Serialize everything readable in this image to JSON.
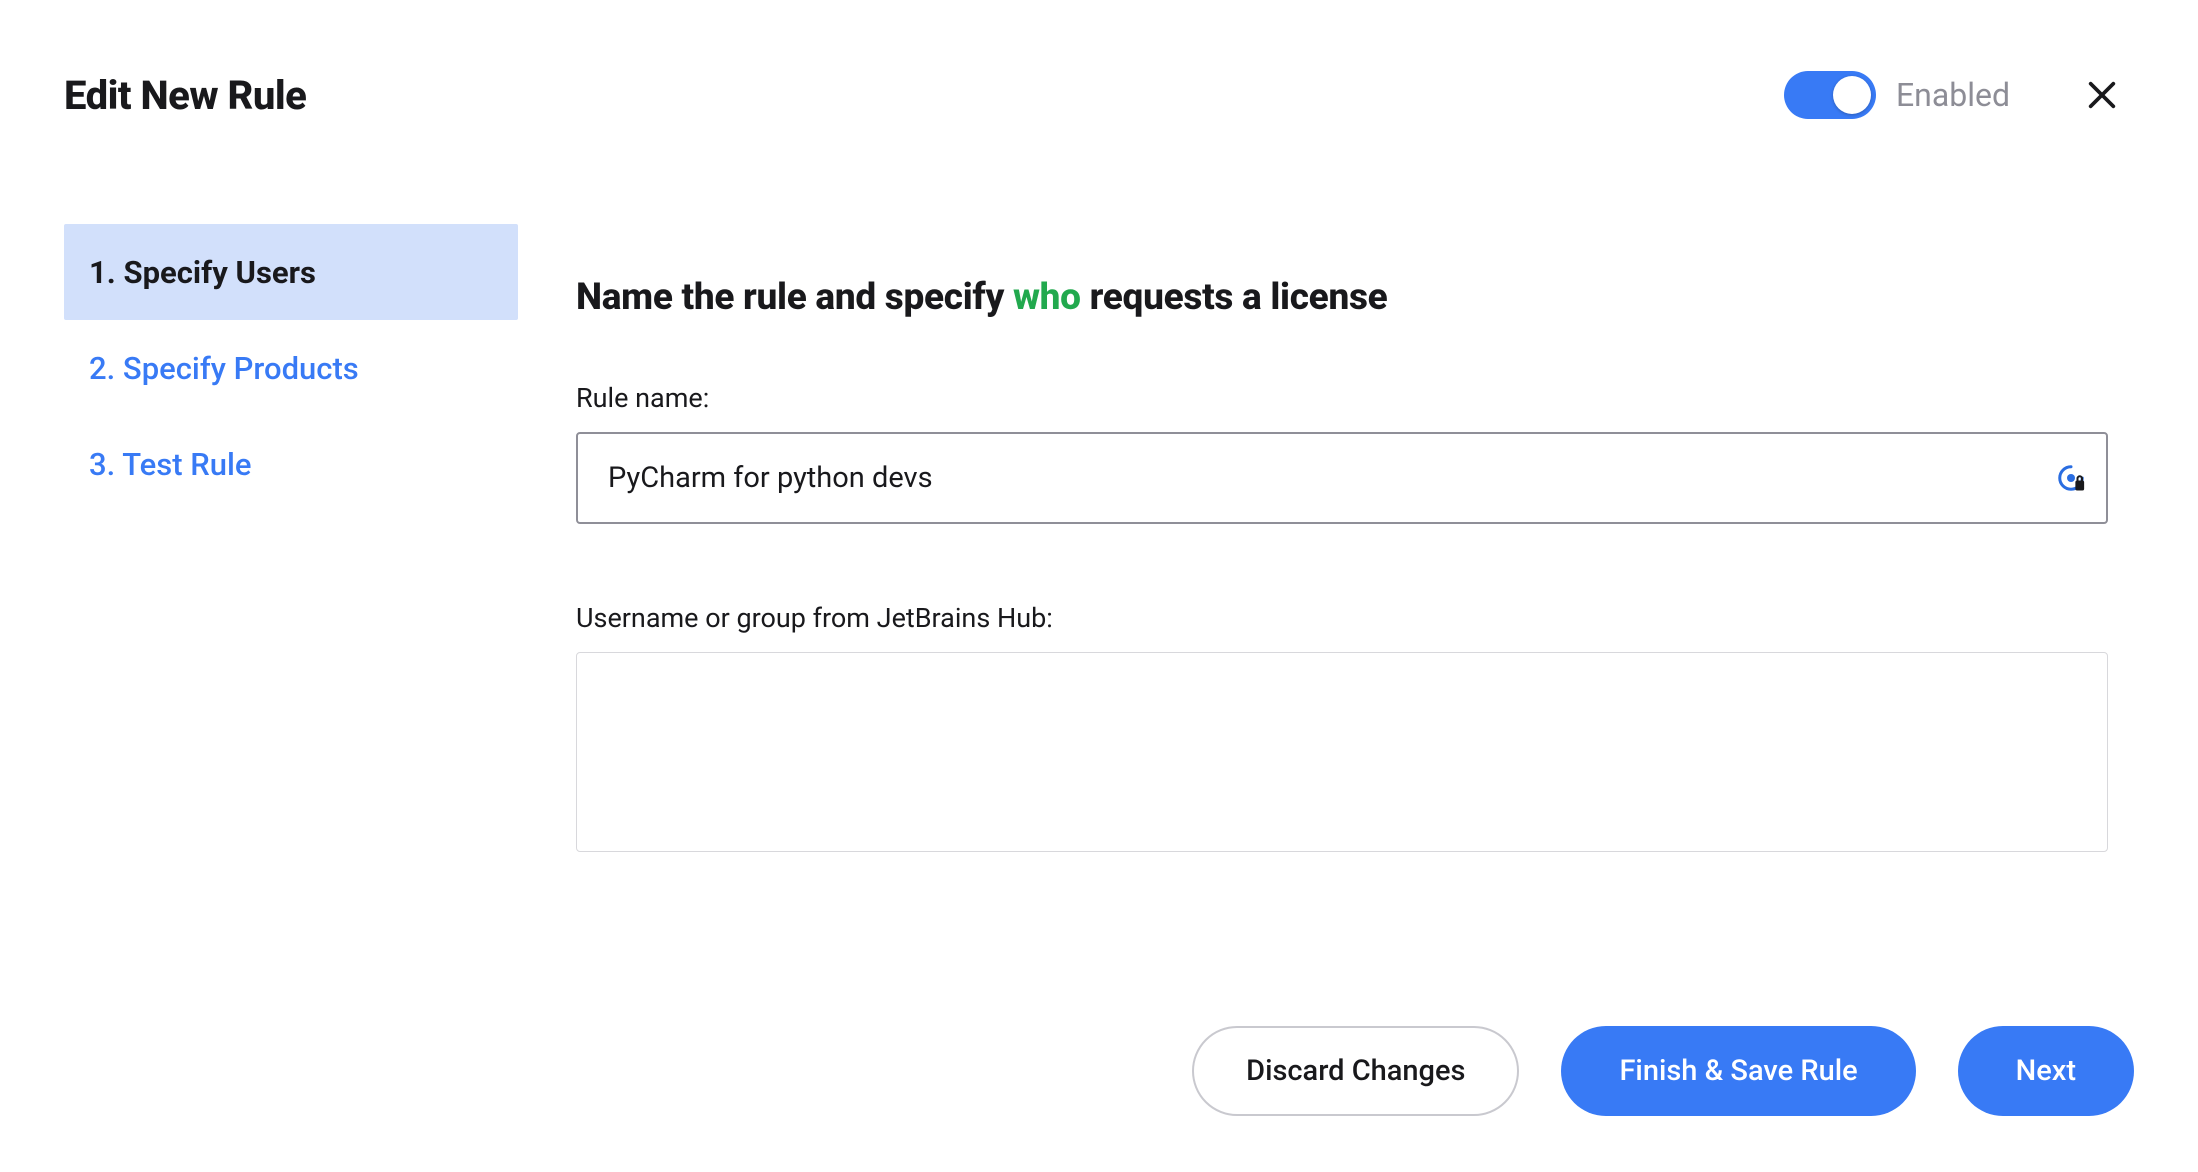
{
  "header": {
    "title": "Edit New Rule",
    "toggle_label": "Enabled",
    "toggle_on": true
  },
  "sidebar": {
    "steps": [
      {
        "label": "1. Specify Users",
        "active": true
      },
      {
        "label": "2. Specify Products",
        "active": false
      },
      {
        "label": "3. Test Rule",
        "active": false
      }
    ]
  },
  "main": {
    "heading_prefix": "Name the rule and specify ",
    "heading_highlight": "who",
    "heading_suffix": " requests a license",
    "rule_name_label": "Rule name:",
    "rule_name_value": "PyCharm for python devs",
    "users_label": "Username or group from JetBrains Hub:",
    "users_value": ""
  },
  "footer": {
    "discard": "Discard Changes",
    "finish": "Finish & Save Rule",
    "next": "Next"
  }
}
